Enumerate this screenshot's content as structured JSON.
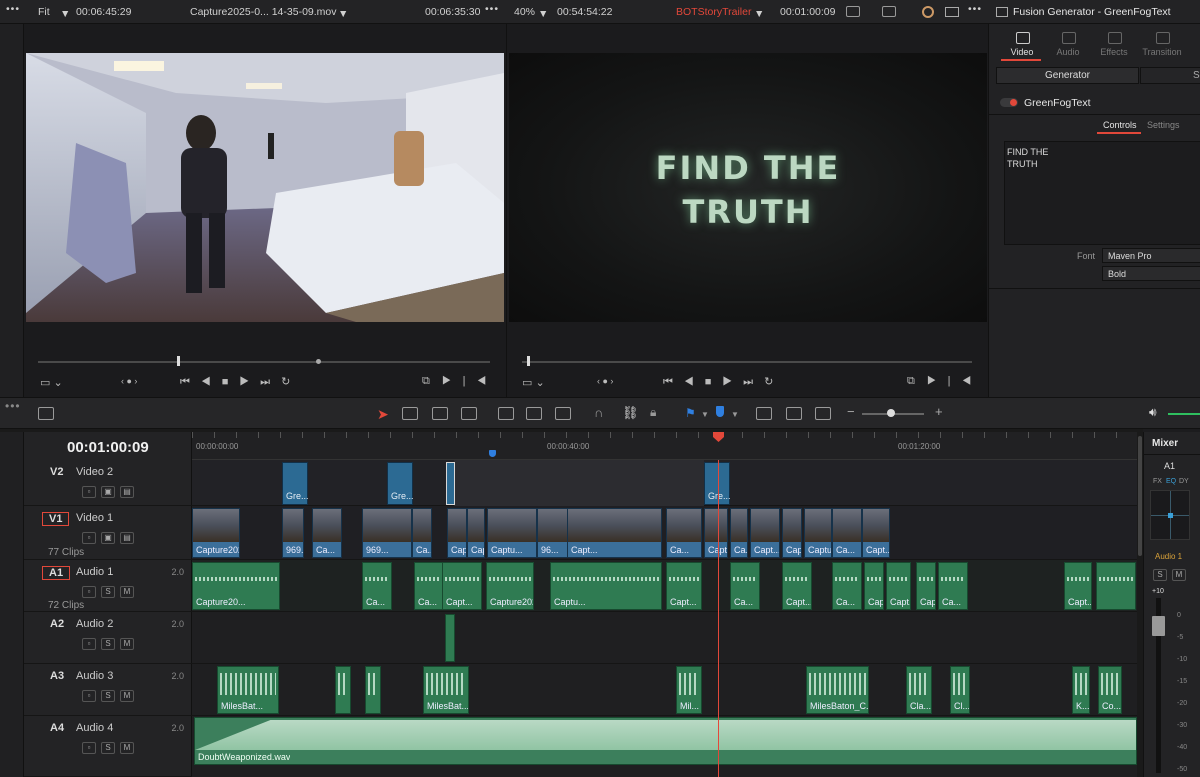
{
  "topbar": {
    "source_zoom": "Fit",
    "source_tc_left": "00:06:45:29",
    "source_clip_name": "Capture2025-0... 14-35-09.mov",
    "source_tc_right": "00:06:35:30",
    "program_zoom": "40%",
    "program_tc_left": "00:54:54:22",
    "timeline_name": "BOTStoryTrailer",
    "program_tc_right": "00:01:00:09",
    "inspector_title": "Fusion Generator - GreenFogText"
  },
  "program_title": {
    "line1": "FIND THE",
    "line2": "TRUTH"
  },
  "inspector": {
    "tabs": [
      "Video",
      "Audio",
      "Effects",
      "Transition"
    ],
    "section_label": "Generator",
    "section_cut": "Se",
    "generator_name": "GreenFogText",
    "subtabs": [
      "Controls",
      "Settings"
    ],
    "text_value_line1": "FIND THE",
    "text_value_line2": "TRUTH",
    "font_label": "Font",
    "font_value": "Maven Pro",
    "style_value": "Bold"
  },
  "timeline": {
    "timecode": "00:01:00:09",
    "ruler": [
      "00:00:00:00",
      "00:00:40:00",
      "00:01:20:00"
    ],
    "tracks": [
      {
        "id": "V2",
        "name": "Video 2",
        "level": ""
      },
      {
        "id": "V1",
        "name": "Video 1",
        "level": "",
        "count": "77 Clips"
      },
      {
        "id": "A1",
        "name": "Audio 1",
        "level": "2.0",
        "count": "72 Clips"
      },
      {
        "id": "A2",
        "name": "Audio 2",
        "level": "2.0"
      },
      {
        "id": "A3",
        "name": "Audio 3",
        "level": "2.0"
      },
      {
        "id": "A4",
        "name": "Audio 4",
        "level": "2.0"
      }
    ],
    "v2_clips": [
      "Gre...",
      "Gre...",
      "Gre..."
    ],
    "v1_clips": [
      "Capture202...",
      "969...",
      "Ca...",
      "969...",
      "Ca...",
      "Capt...",
      "Capture2025-07-11 15...",
      "Captu...",
      "96...",
      "Capt...",
      "Ca...",
      "Capt...",
      "Ca...",
      "Capt...",
      "Capt...",
      "Captu...",
      "Ca...",
      "Capt..."
    ],
    "a1_clips": [
      "Capture20...",
      "Ca...",
      "Ca...",
      "Capt...",
      "Capture2025-07-...",
      "Captu...",
      "Capt...",
      "Ca...",
      "Capt...",
      "Ca...",
      "Cap...",
      "Capt...",
      "Captu...",
      "Ca...",
      "Capt..."
    ],
    "a3_clips": [
      "MilesBat...",
      "MilesBat...",
      "Mil...",
      "MilesBaton_C...",
      "Cla...",
      "Cl...",
      "K...",
      "Co..."
    ],
    "a4_clip": "DoubtWeaponized.wav"
  },
  "mixer": {
    "title": "Mixer",
    "channel": "A1",
    "fx_tabs": [
      "FX",
      "EQ",
      "DY"
    ],
    "bus_label": "Audio 1",
    "gain": "+10",
    "scale": [
      "0",
      "-5",
      "-10",
      "-15",
      "-20",
      "-30",
      "-40",
      "-50"
    ]
  },
  "colors": {
    "accent_red": "#e2483a",
    "clip_video": "#3b6f9a",
    "clip_audio": "#2f7b52",
    "title_green": "#bcd8c2",
    "eq_blue": "#3aa0d8"
  },
  "icons": [
    "more-icon",
    "chevron-down-icon",
    "prev-icon",
    "play-icon",
    "stop-icon",
    "next-icon",
    "loop-icon",
    "select-icon",
    "razor-icon",
    "link-icon",
    "lock-icon",
    "flag-icon",
    "marker-icon",
    "zoom-icon",
    "speaker-icon"
  ]
}
